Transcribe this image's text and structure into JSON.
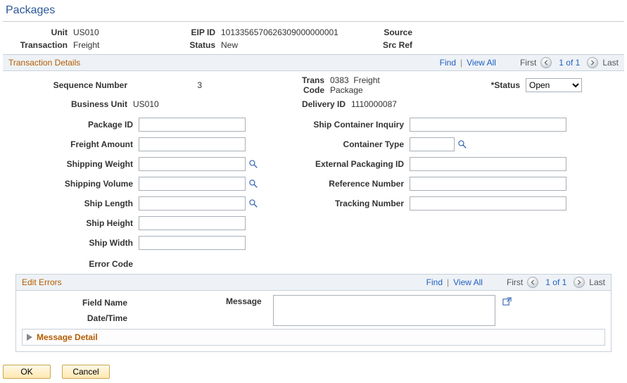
{
  "page_title": "Packages",
  "header": {
    "unit_label": "Unit",
    "unit_value": "US010",
    "eip_id_label": "EIP ID",
    "eip_id_value": "1013356570626309000000001",
    "source_label": "Source",
    "source_value": "",
    "transaction_label": "Transaction",
    "transaction_value": "Freight",
    "status_label": "Status",
    "status_value": "New",
    "src_ref_label": "Src Ref",
    "src_ref_value": ""
  },
  "bar": {
    "details_title": "Transaction Details",
    "find": "Find",
    "view_all": "View All",
    "first": "First",
    "counter": "1 of 1",
    "last": "Last"
  },
  "details": {
    "seq_label": "Sequence Number",
    "seq_value": "3",
    "trans_code_label": "Trans Code",
    "trans_code_value": "0383",
    "trans_code_desc": "Freight Package",
    "status_label": "*Status",
    "status_value": "Open",
    "bu_label": "Business Unit",
    "bu_value": "US010",
    "delivery_id_label": "Delivery ID",
    "delivery_id_value": "1110000087",
    "left_fields": {
      "package_id": "Package ID",
      "freight_amount": "Freight Amount",
      "shipping_weight": "Shipping Weight",
      "shipping_volume": "Shipping Volume",
      "ship_length": "Ship Length",
      "ship_height": "Ship Height",
      "ship_width": "Ship Width"
    },
    "right_fields": {
      "ship_container_inquiry": "Ship Container Inquiry",
      "container_type": "Container Type",
      "external_packaging_id": "External Packaging ID",
      "reference_number": "Reference Number",
      "tracking_number": "Tracking Number"
    },
    "error_code_label": "Error Code"
  },
  "edit_errors": {
    "title": "Edit Errors",
    "field_name_label": "Field Name",
    "date_time_label": "Date/Time",
    "message_label": "Message",
    "message_value": "",
    "message_detail_title": "Message Detail"
  },
  "buttons": {
    "ok": "OK",
    "cancel": "Cancel"
  }
}
